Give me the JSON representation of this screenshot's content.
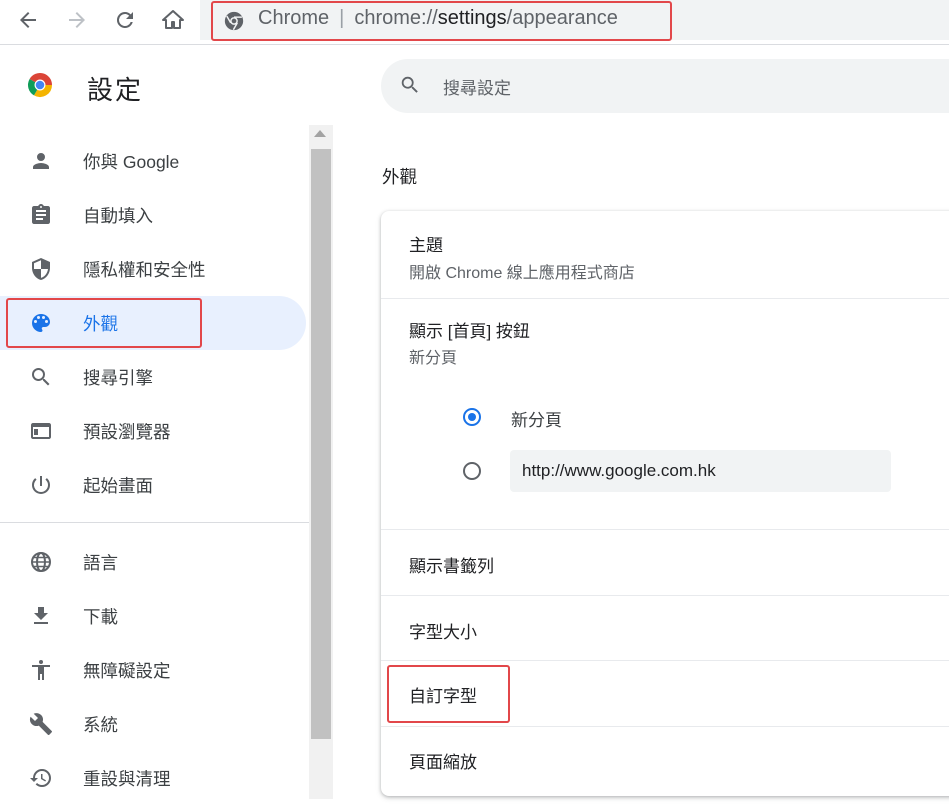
{
  "omnibox": {
    "site_label": "Chrome",
    "url_scheme": "chrome://",
    "url_host": "settings",
    "url_path": "/appearance"
  },
  "header": {
    "title": "設定",
    "search_placeholder": "搜尋設定"
  },
  "sidebar": {
    "items": [
      {
        "label": "你與 Google",
        "icon": "person-icon"
      },
      {
        "label": "自動填入",
        "icon": "clipboard-icon"
      },
      {
        "label": "隱私權和安全性",
        "icon": "shield-icon"
      },
      {
        "label": "外觀",
        "icon": "palette-icon",
        "active": true
      },
      {
        "label": "搜尋引擎",
        "icon": "search-icon"
      },
      {
        "label": "預設瀏覽器",
        "icon": "browser-window-icon"
      },
      {
        "label": "起始畫面",
        "icon": "power-icon"
      },
      {
        "label": "語言",
        "icon": "globe-icon"
      },
      {
        "label": "下載",
        "icon": "download-icon"
      },
      {
        "label": "無障礙設定",
        "icon": "accessibility-icon"
      },
      {
        "label": "系統",
        "icon": "wrench-icon"
      },
      {
        "label": "重設與清理",
        "icon": "restore-icon"
      }
    ]
  },
  "main": {
    "section_title": "外觀",
    "theme": {
      "title": "主題",
      "subtitle": "開啟 Chrome 線上應用程式商店"
    },
    "home_button": {
      "title": "顯示 [首頁] 按鈕",
      "subtitle": "新分頁",
      "option_newtab": "新分頁",
      "custom_url_value": "http://www.google.com.hk",
      "selected": "newtab"
    },
    "bookmarks_bar": "顯示書籤列",
    "font_size": "字型大小",
    "custom_fonts": "自訂字型",
    "page_zoom": "頁面縮放"
  },
  "colors": {
    "accent": "#1a73e8",
    "active_nav_bg": "#e8f0fe",
    "annotation_red": "#e2474a"
  }
}
